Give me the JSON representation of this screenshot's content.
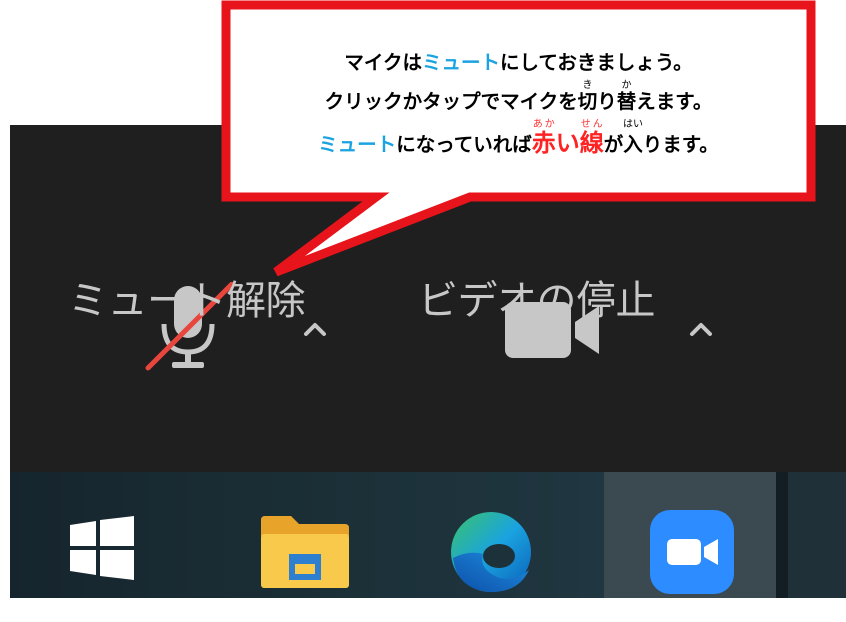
{
  "callout": {
    "line1": [
      {
        "t": "マイクは",
        "s": "n"
      },
      {
        "t": "ミュート",
        "s": "blue"
      },
      {
        "t": "にしておきましょう。",
        "s": "n"
      }
    ],
    "line2": [
      {
        "t": "クリックかタップでマイクを",
        "s": "n"
      },
      {
        "t": "切",
        "rt": "き",
        "s": "ruby"
      },
      {
        "t": "り",
        "s": "n"
      },
      {
        "t": "替",
        "rt": "か",
        "s": "ruby"
      },
      {
        "t": "えます。",
        "s": "n"
      }
    ],
    "line3": [
      {
        "t": "ミュート",
        "s": "blue"
      },
      {
        "t": "になっていれば",
        "s": "n"
      },
      {
        "t": "赤",
        "rt": "あか",
        "s": "ruby-red"
      },
      {
        "t": "い",
        "s": "red"
      },
      {
        "t": "線",
        "rt": "せん",
        "s": "ruby-red"
      },
      {
        "t": "が",
        "s": "n"
      },
      {
        "t": "入",
        "rt": "はい",
        "s": "ruby"
      },
      {
        "t": "ります。",
        "s": "n"
      }
    ]
  },
  "toolbar": {
    "mute_label": "ミュート解除",
    "video_label": "ビデオの停止",
    "mic_icon": "microphone-muted-icon",
    "video_icon": "video-camera-icon",
    "chevron_icon": "chevron-up-icon"
  },
  "taskbar": {
    "items": [
      {
        "icon": "windows-start-icon"
      },
      {
        "icon": "file-explorer-icon"
      },
      {
        "icon": "edge-browser-icon"
      },
      {
        "icon": "zoom-app-icon",
        "active": true
      }
    ]
  },
  "colors": {
    "callout_border": "#e8141c",
    "highlight_blue": "#1aa3e0",
    "highlight_red": "#ff2222",
    "toolbar_bg": "#1f1f1f",
    "icon_gray": "#c7c7c7",
    "zoom_blue": "#2d8cff"
  }
}
